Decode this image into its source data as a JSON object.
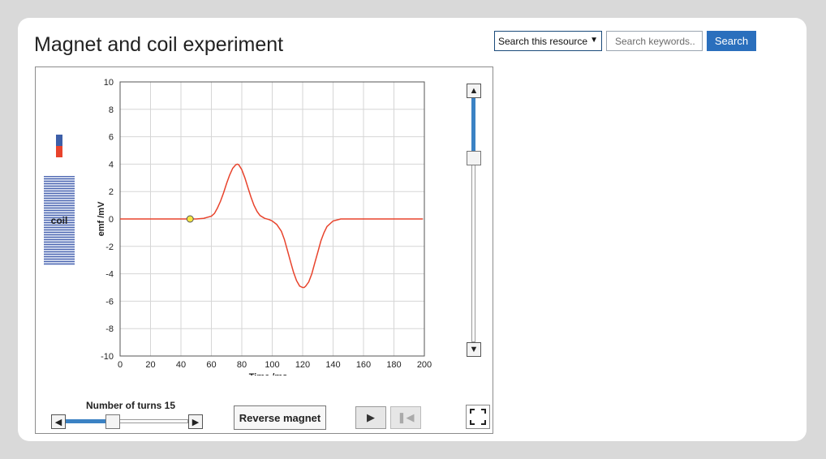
{
  "page": {
    "title": "Magnet and coil experiment"
  },
  "search": {
    "scope_selected": "Search this resource",
    "placeholder": "Search keywords..",
    "button_label": "Search"
  },
  "simulation": {
    "coil_label": "coil",
    "turns_label": "Number  of turns 15",
    "turns_value": 15,
    "reverse_button_label": "Reverse magnet",
    "play_icon": "play-icon",
    "reset_icon": "skip-to-start-icon",
    "fullscreen_icon": "fullscreen-icon",
    "vertical_slider_level": 0.25,
    "magnet_colors": {
      "north": "#3d5fa8",
      "south": "#e8432c"
    },
    "accent_color": "#3b82c4"
  },
  "chart_data": {
    "type": "line",
    "title": "",
    "xlabel": "Time /ms",
    "ylabel": "emf /mV",
    "xlim": [
      0,
      200
    ],
    "ylim": [
      -10,
      10
    ],
    "xticks": [
      "0",
      "20",
      "40",
      "60",
      "80",
      "100",
      "120",
      "140",
      "160",
      "180",
      "200"
    ],
    "yticks": [
      "10",
      "8",
      "6",
      "4",
      "2",
      "0",
      "-2",
      "-4",
      "-6",
      "-8",
      "-10"
    ],
    "grid": true,
    "series": [
      {
        "color": "#e8432c",
        "x": [
          0,
          10,
          20,
          30,
          40,
          50,
          55,
          60,
          62,
          64,
          66,
          68,
          70,
          72,
          74,
          76,
          77,
          78,
          80,
          82,
          84,
          86,
          88,
          90,
          92,
          95,
          98,
          100,
          103,
          106,
          108,
          110,
          112,
          114,
          116,
          118,
          120,
          121,
          122,
          124,
          126,
          128,
          130,
          132,
          134,
          136,
          140,
          145,
          150,
          160,
          170,
          180,
          190,
          199
        ],
        "y": [
          0,
          0,
          0,
          0,
          0,
          0,
          0.05,
          0.2,
          0.4,
          0.8,
          1.3,
          1.9,
          2.6,
          3.2,
          3.7,
          3.95,
          4.0,
          3.95,
          3.6,
          3.0,
          2.3,
          1.6,
          1.0,
          0.55,
          0.25,
          0.05,
          -0.05,
          -0.15,
          -0.4,
          -0.9,
          -1.5,
          -2.3,
          -3.1,
          -3.9,
          -4.5,
          -4.9,
          -5.0,
          -5.0,
          -4.9,
          -4.6,
          -4.0,
          -3.2,
          -2.4,
          -1.6,
          -1.0,
          -0.55,
          -0.15,
          0,
          0,
          0,
          0,
          0,
          0,
          0
        ]
      }
    ],
    "marker": {
      "x": 46,
      "y": 0,
      "color": "#f5e642"
    }
  }
}
